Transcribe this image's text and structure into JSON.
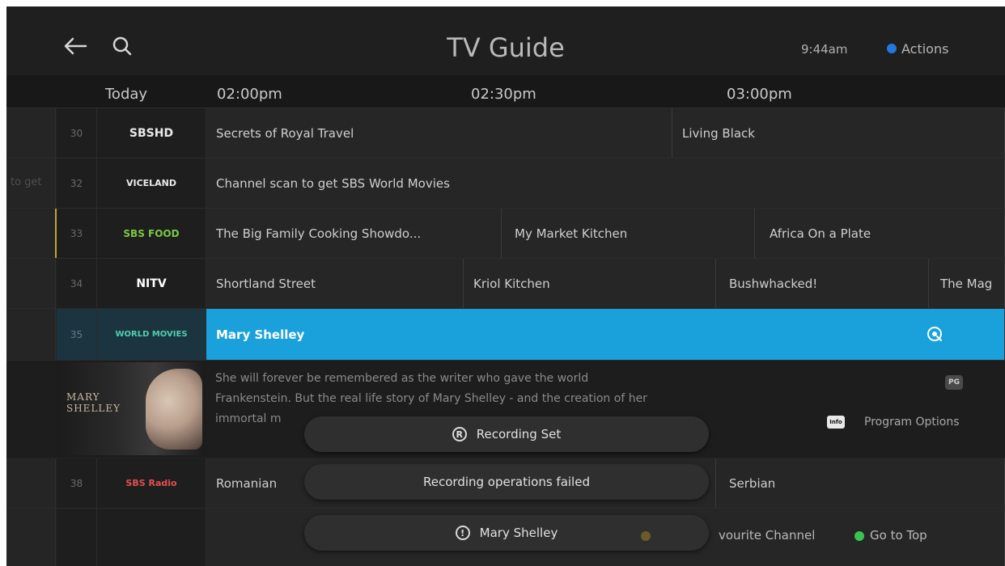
{
  "header": {
    "title": "TV Guide",
    "clock": "9:44am",
    "actions_label": "Actions",
    "icons": {
      "back": "back-arrow-icon",
      "search": "search-icon"
    },
    "colors": {
      "actions_dot": "#1f7ae0"
    }
  },
  "timeline": {
    "day": "Today",
    "times": [
      "02:00pm",
      "02:30pm",
      "03:00pm"
    ]
  },
  "rows": [
    {
      "number": "30",
      "logo": "SBSHD",
      "edge": "",
      "programs": [
        "Secrets of Royal Travel",
        "Living Black"
      ]
    },
    {
      "number": "32",
      "logo": "VICELAND",
      "edge": "to get",
      "programs": [
        "Channel scan to get SBS World Movies"
      ]
    },
    {
      "number": "33",
      "logo": "SBS FOOD",
      "edge": "",
      "programs": [
        "The Big Family Cooking Showdo...",
        "My Market Kitchen",
        "Africa On a Plate"
      ]
    },
    {
      "number": "34",
      "logo": "NITV",
      "edge": "",
      "programs": [
        "Shortland Street",
        "Kriol Kitchen",
        "Bushwhacked!",
        "The Mag"
      ]
    },
    {
      "number": "35",
      "logo": "WORLD MOVIES",
      "edge": "",
      "programs": [
        "Mary Shelley"
      ]
    },
    {
      "number": "38",
      "logo": "SBS Radio",
      "edge": "",
      "programs": [
        "Romanian",
        "Serbian"
      ]
    }
  ],
  "details": {
    "poster_title": "MARY SHELLEY",
    "synopsis_line1": "She will forever be remembered as the writer who gave the world",
    "synopsis_line2": "Frankenstein. But the real life story of Mary Shelley - and the creation of her",
    "synopsis_line3": "immortal m",
    "rating": "PG",
    "info_icon": "Info",
    "program_options": "Program Options"
  },
  "toasts": {
    "recording_set": "Recording Set",
    "recording_failed": "Recording operations failed",
    "program_name": "Mary Shelley"
  },
  "legend": {
    "favourite": "vourite Channel",
    "go_to_top": "Go to Top",
    "colors": {
      "favourite": "#c8a23a",
      "go_to_top": "#37c451"
    }
  }
}
